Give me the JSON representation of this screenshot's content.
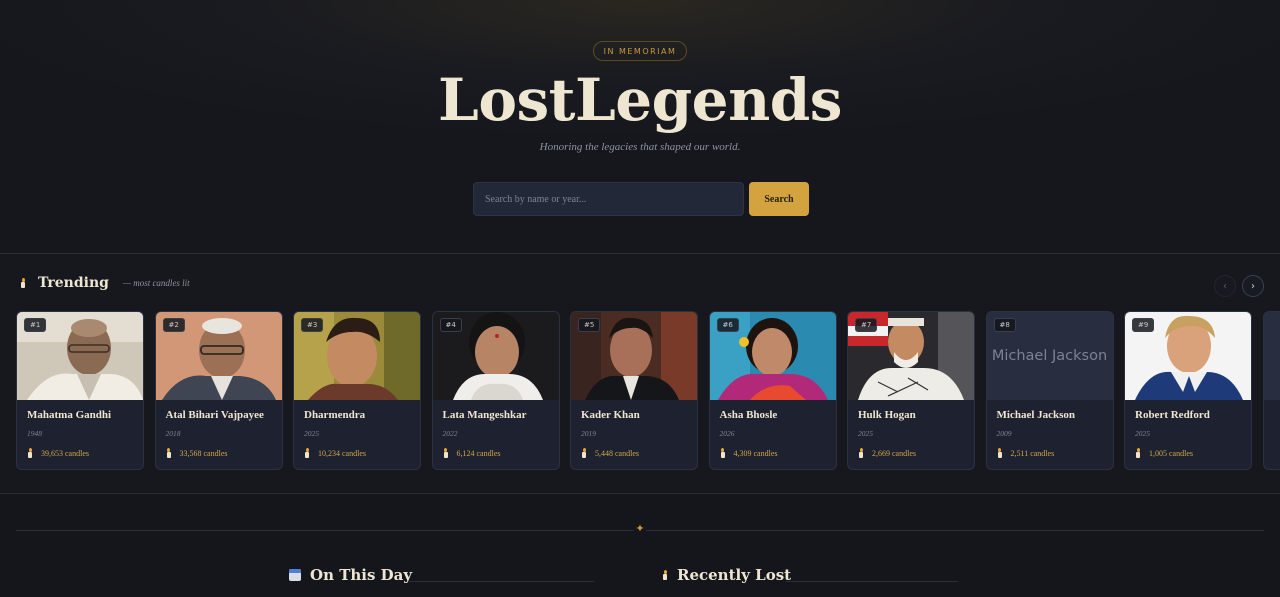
{
  "hero": {
    "badge": "IN MEMORIAM",
    "title": "LostLegends",
    "tagline": "Honoring the legacies that shaped our world.",
    "search_placeholder": "Search by name or year...",
    "search_button": "Search"
  },
  "trending": {
    "title": "Trending",
    "subtitle": "— most candles lit",
    "prev_icon": "chevron-left-icon",
    "next_icon": "chevron-right-icon",
    "prev_glyph": "‹",
    "next_glyph": "›",
    "cards": [
      {
        "rank": "#1",
        "name": "Mahatma Gandhi",
        "year": "1948",
        "candles": "39,653 candles"
      },
      {
        "rank": "#2",
        "name": "Atal Bihari Vajpayee",
        "year": "2018",
        "candles": "33,568 candles"
      },
      {
        "rank": "#3",
        "name": "Dharmendra",
        "year": "2025",
        "candles": "10,234 candles"
      },
      {
        "rank": "#4",
        "name": "Lata Mangeshkar",
        "year": "2022",
        "candles": "6,124 candles"
      },
      {
        "rank": "#5",
        "name": "Kader Khan",
        "year": "2019",
        "candles": "5,448 candles"
      },
      {
        "rank": "#6",
        "name": "Asha Bhosle",
        "year": "2026",
        "candles": "4,309 candles"
      },
      {
        "rank": "#7",
        "name": "Hulk Hogan",
        "year": "2025",
        "candles": "2,669 candles"
      },
      {
        "rank": "#8",
        "name": "Michael Jackson",
        "year": "2009",
        "candles": "2,511 candles",
        "photo_placeholder": "Michael Jackson"
      },
      {
        "rank": "#9",
        "name": "Robert Redford",
        "year": "2025",
        "candles": "1,005 candles"
      }
    ]
  },
  "divider_glyph": "✦",
  "sections": {
    "on_this_day": "On This Day",
    "recently_lost": "Recently Lost"
  },
  "colors": {
    "accent": "#d2a33e",
    "background": "#14161c",
    "card": "#1e2230"
  }
}
